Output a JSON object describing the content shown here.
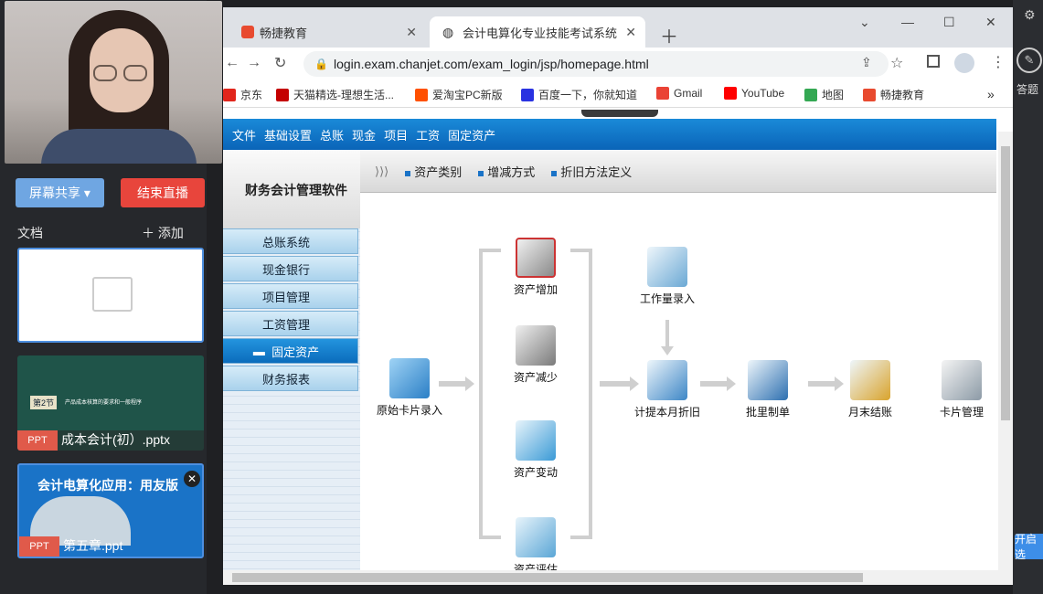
{
  "left_panel": {
    "share_button": "屏幕共享",
    "end_button": "结束直播",
    "docs_label": "文档",
    "add_label": "添加",
    "docs": [
      {
        "type": "",
        "name": "",
        "thumb_text": ""
      },
      {
        "type": "PPT",
        "name": "成本会计(初）.pptx",
        "thumb_text": "产品成本核算的要求和一般程序",
        "thumb_badge": "第2节"
      },
      {
        "type": "PPT",
        "name": "第五章.ppt",
        "thumb_text": "会计电算化应用：用友版"
      }
    ]
  },
  "browser": {
    "tabs": [
      {
        "label": "畅捷教育"
      },
      {
        "label": "会计电算化专业技能考试系统"
      }
    ],
    "url": "login.exam.chanjet.com/exam_login/jsp/homepage.html",
    "bookmarks": [
      "京东",
      "天猫精选-理想生活...",
      "爱淘宝PC新版",
      "百度一下，你就知道",
      "Gmail",
      "YouTube",
      "地图",
      "畅捷教育"
    ]
  },
  "app": {
    "menu": [
      "文件",
      "基础设置",
      "总账",
      "现金",
      "项目",
      "工资",
      "固定资产"
    ],
    "logo": "财务会计管理软件",
    "subnav": [
      "资产类别",
      "增减方式",
      "折旧方法定义"
    ],
    "sidenav": [
      "总账系统",
      "现金银行",
      "项目管理",
      "工资管理",
      "固定资产",
      "财务报表"
    ],
    "active_sidenav": "固定资产",
    "flow": {
      "card_entry": "原始卡片录入",
      "asset_add": "资产增加",
      "asset_reduce": "资产减少",
      "asset_change": "资产变动",
      "asset_eval": "资产评估",
      "workload": "工作量录入",
      "depreciation": "计提本月折旧",
      "batch_voucher": "批里制单",
      "month_end": "月末结账",
      "card_mgmt": "卡片管理"
    }
  },
  "right_strip": {
    "label": "答题",
    "button": "开启选"
  },
  "colors": {
    "menu_blue": "#0a64b8",
    "end_red": "#e8453c",
    "share_blue": "#6fa6e2"
  }
}
